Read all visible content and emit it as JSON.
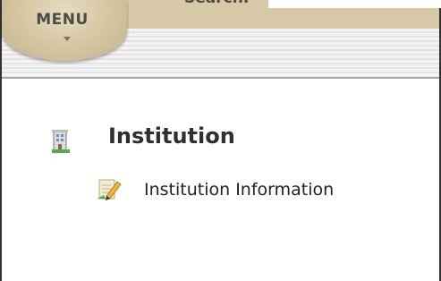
{
  "header": {
    "menu_label": "MENU",
    "search_label": "Search:",
    "search_value": ""
  },
  "section": {
    "title": "Institution",
    "icon": "building-icon",
    "items": [
      {
        "label": "Institution Information",
        "icon": "edit-document-icon"
      }
    ]
  }
}
